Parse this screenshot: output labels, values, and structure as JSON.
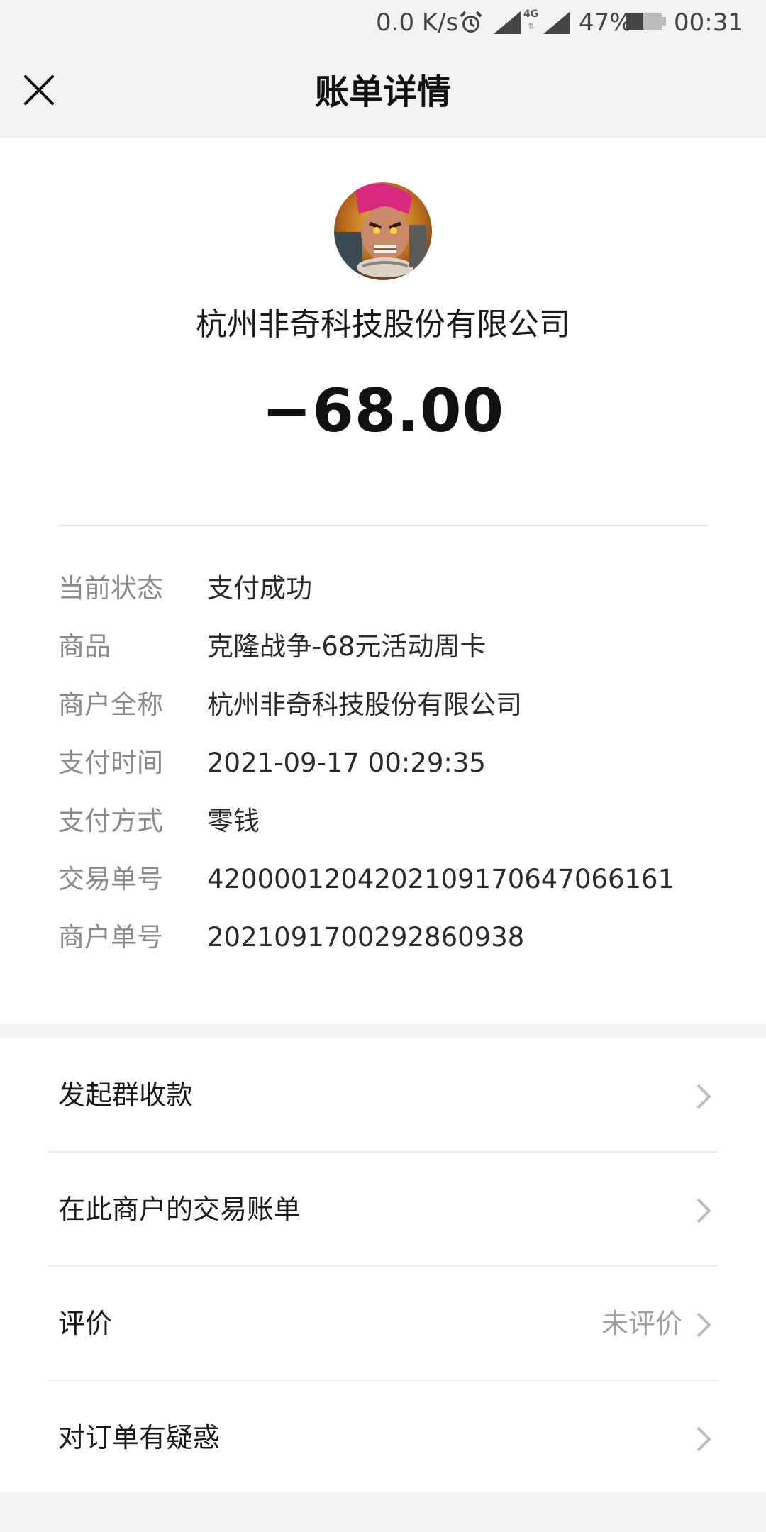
{
  "status_bar": {
    "speed": "0.0 K/s",
    "network": "4G",
    "battery": "47%",
    "time": "00:31"
  },
  "header": {
    "title": "账单详情"
  },
  "summary": {
    "merchant": "杭州非奇科技股份有限公司",
    "amount": "−68.00"
  },
  "details": [
    {
      "label": "当前状态",
      "value": "支付成功"
    },
    {
      "label": "商品",
      "value": "克隆战争-68元活动周卡"
    },
    {
      "label": "商户全称",
      "value": "杭州非奇科技股份有限公司"
    },
    {
      "label": "支付时间",
      "value": "2021-09-17 00:29:35"
    },
    {
      "label": "支付方式",
      "value": "零钱"
    },
    {
      "label": "交易单号",
      "value": "4200001204202109170647066161"
    },
    {
      "label": "商户单号",
      "value": "2021091700292860938"
    }
  ],
  "actions": [
    {
      "label": "发起群收款",
      "extra": ""
    },
    {
      "label": "在此商户的交易账单",
      "extra": ""
    },
    {
      "label": "评价",
      "extra": "未评价"
    },
    {
      "label": "对订单有疑惑",
      "extra": ""
    }
  ],
  "icons": {
    "close": "close-icon",
    "chevron": "chevron-right-icon",
    "alarm": "alarm-icon",
    "signal": "signal-icon",
    "battery": "battery-icon"
  },
  "colors": {
    "background": "#f2f2f2",
    "card": "#ffffff",
    "label_gray": "#8a8a8a",
    "text_dark": "#1a1a1a"
  }
}
